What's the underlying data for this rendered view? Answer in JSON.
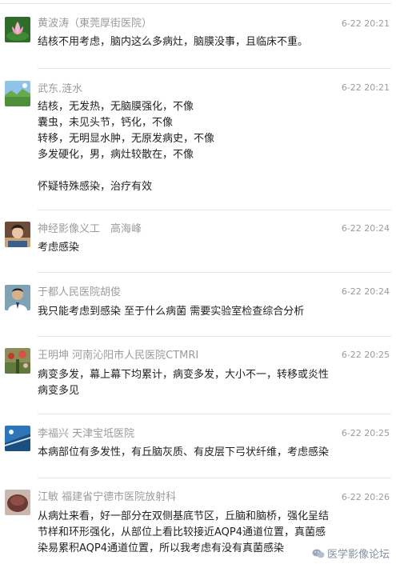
{
  "comments": [
    {
      "author": "黄波涛（東莞厚街医院）",
      "time": "6-22 20:21",
      "body": "结核不用考虑，脑内这么多病灶，脑膜没事，且临床不重。",
      "avatar_icon": "lotus-flower-avatar"
    },
    {
      "author": "武东.涟水",
      "time": "6-22 20:21",
      "body": "结核，无发热，无脑膜强化，不像\n囊虫，未见头节，钙化，不像\n转移，无明显水肿，无原发病史，不像\n多发硬化，男，病灶较散在，不像\n\n怀疑特殊感染，治疗有效",
      "avatar_icon": "landscape-avatar"
    },
    {
      "author": "神经影像义工　高海峰",
      "time": "6-22 20:24",
      "body": "考虑感染",
      "avatar_icon": "portrait-avatar"
    },
    {
      "author": "于都人民医院胡俊",
      "time": "6-22 20:24",
      "body": "我只能考虑到感染  至于什么病菌 需要实验室检查综合分析",
      "avatar_icon": "person-photo-avatar"
    },
    {
      "author": "王明坤  河南沁阳市人民医院CTMRI",
      "time": "6-22 20:25",
      "body": "病变多发，幕上幕下均累计，病变多发，大小不一，转移或炎性\n病变多见",
      "avatar_icon": "garden-avatar"
    },
    {
      "author": "李福兴 天津宝坻医院",
      "time": "6-22 20:25",
      "body": "本病部位有多发性，有丘脑灰质、有皮层下弓状纤维，考虑感染",
      "avatar_icon": "sky-avatar"
    },
    {
      "author": "江敏  福建省宁德市医院放射科",
      "time": "6-22 20:26",
      "body": "从病灶来看，好一部分在双侧基底节区，丘脑和脑桥，强化呈结\n节样和环形强化，从部位上看比较接近AQP4通道位置，真菌感\n染易累积AQP4通道位置，所以我考虑有没有真菌感染",
      "avatar_icon": "round-object-avatar"
    }
  ],
  "watermark": "医学影像论坛",
  "watermark_icon": "wechat-icon"
}
